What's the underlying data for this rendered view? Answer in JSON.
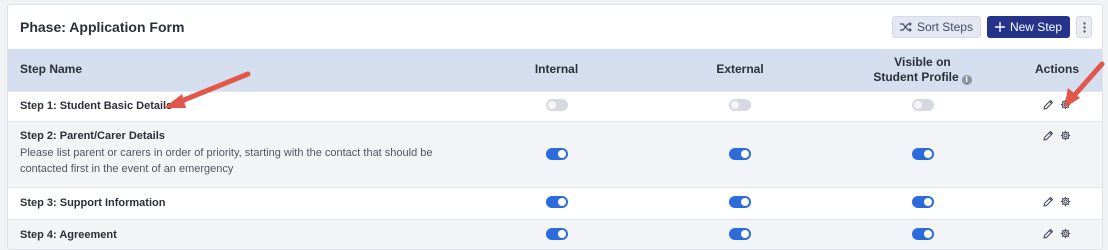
{
  "header": {
    "title": "Phase: Application Form",
    "sort_label": "Sort Steps",
    "new_label": "New Step"
  },
  "columns": {
    "name": "Step Name",
    "internal": "Internal",
    "external": "External",
    "visible_line1": "Visible on",
    "visible_line2": "Student Profile",
    "actions": "Actions"
  },
  "steps": [
    {
      "name": "Step 1: Student Basic Details",
      "description": "",
      "internal": "disabled",
      "external": "disabled",
      "visible": "disabled"
    },
    {
      "name": "Step 2: Parent/Carer Details",
      "description": "Please list parent or carers in order of priority, starting with the contact that should be contacted first in the event of an emergency",
      "internal": "on",
      "external": "on",
      "visible": "on"
    },
    {
      "name": "Step 3: Support Information",
      "description": "",
      "internal": "on",
      "external": "on",
      "visible": "on"
    },
    {
      "name": "Step 4: Agreement",
      "description": "",
      "internal": "on",
      "external": "on",
      "visible": "on"
    }
  ],
  "colors": {
    "primary_button": "#25348a",
    "toggle_on": "#2c6bdc",
    "header_row": "#d4deee",
    "annotation_arrow": "#e2574c"
  },
  "icons": {
    "sort": "shuffle-icon",
    "new": "plus-icon",
    "more": "kebab-menu-icon",
    "edit": "pencil-icon",
    "settings": "gear-icon",
    "info": "info-icon"
  }
}
